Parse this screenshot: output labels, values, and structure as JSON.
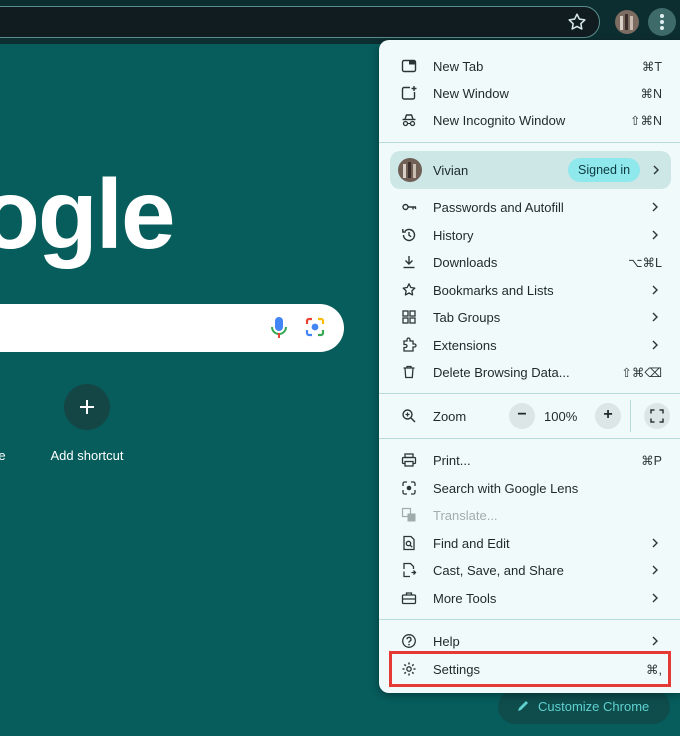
{
  "page": {
    "logo_text": "ogle",
    "partial_shortcut_label": "re",
    "add_shortcut_label": "Add shortcut",
    "customize_label": "Customize Chrome"
  },
  "menu": {
    "group1": [
      {
        "label": "New Tab",
        "shortcut": "⌘T",
        "icon": "new-tab-icon"
      },
      {
        "label": "New Window",
        "shortcut": "⌘N",
        "icon": "new-window-icon"
      },
      {
        "label": "New Incognito Window",
        "shortcut": "⇧⌘N",
        "icon": "incognito-icon"
      }
    ],
    "profile": {
      "name": "Vivian",
      "badge": "Signed in"
    },
    "group2": [
      {
        "label": "Passwords and Autofill",
        "icon": "key-icon"
      },
      {
        "label": "History",
        "icon": "history-icon"
      },
      {
        "label": "Downloads",
        "shortcut": "⌥⌘L",
        "icon": "download-icon"
      },
      {
        "label": "Bookmarks and Lists",
        "icon": "star-icon"
      },
      {
        "label": "Tab Groups",
        "icon": "tab-groups-icon"
      },
      {
        "label": "Extensions",
        "icon": "extensions-icon"
      },
      {
        "label": "Delete Browsing Data...",
        "shortcut": "⇧⌘⌫",
        "icon": "trash-icon"
      }
    ],
    "zoom": {
      "label": "Zoom",
      "value": "100%",
      "minus": "−",
      "plus": "+"
    },
    "group3": [
      {
        "label": "Print...",
        "shortcut": "⌘P",
        "icon": "print-icon"
      },
      {
        "label": "Search with Google Lens",
        "icon": "lens-icon"
      },
      {
        "label": "Translate...",
        "icon": "translate-icon",
        "disabled": true
      },
      {
        "label": "Find and Edit",
        "icon": "find-icon"
      },
      {
        "label": "Cast, Save, and Share",
        "icon": "cast-icon"
      },
      {
        "label": "More Tools",
        "icon": "toolbox-icon"
      }
    ],
    "group4": [
      {
        "label": "Help",
        "icon": "help-icon"
      },
      {
        "label": "Settings",
        "shortcut": "⌘,",
        "icon": "gear-icon"
      }
    ]
  },
  "colors": {
    "page_bg": "#075c5c",
    "menu_bg": "#f1fafa",
    "highlight": "#e53935",
    "badge_bg": "#8fe8ec"
  }
}
